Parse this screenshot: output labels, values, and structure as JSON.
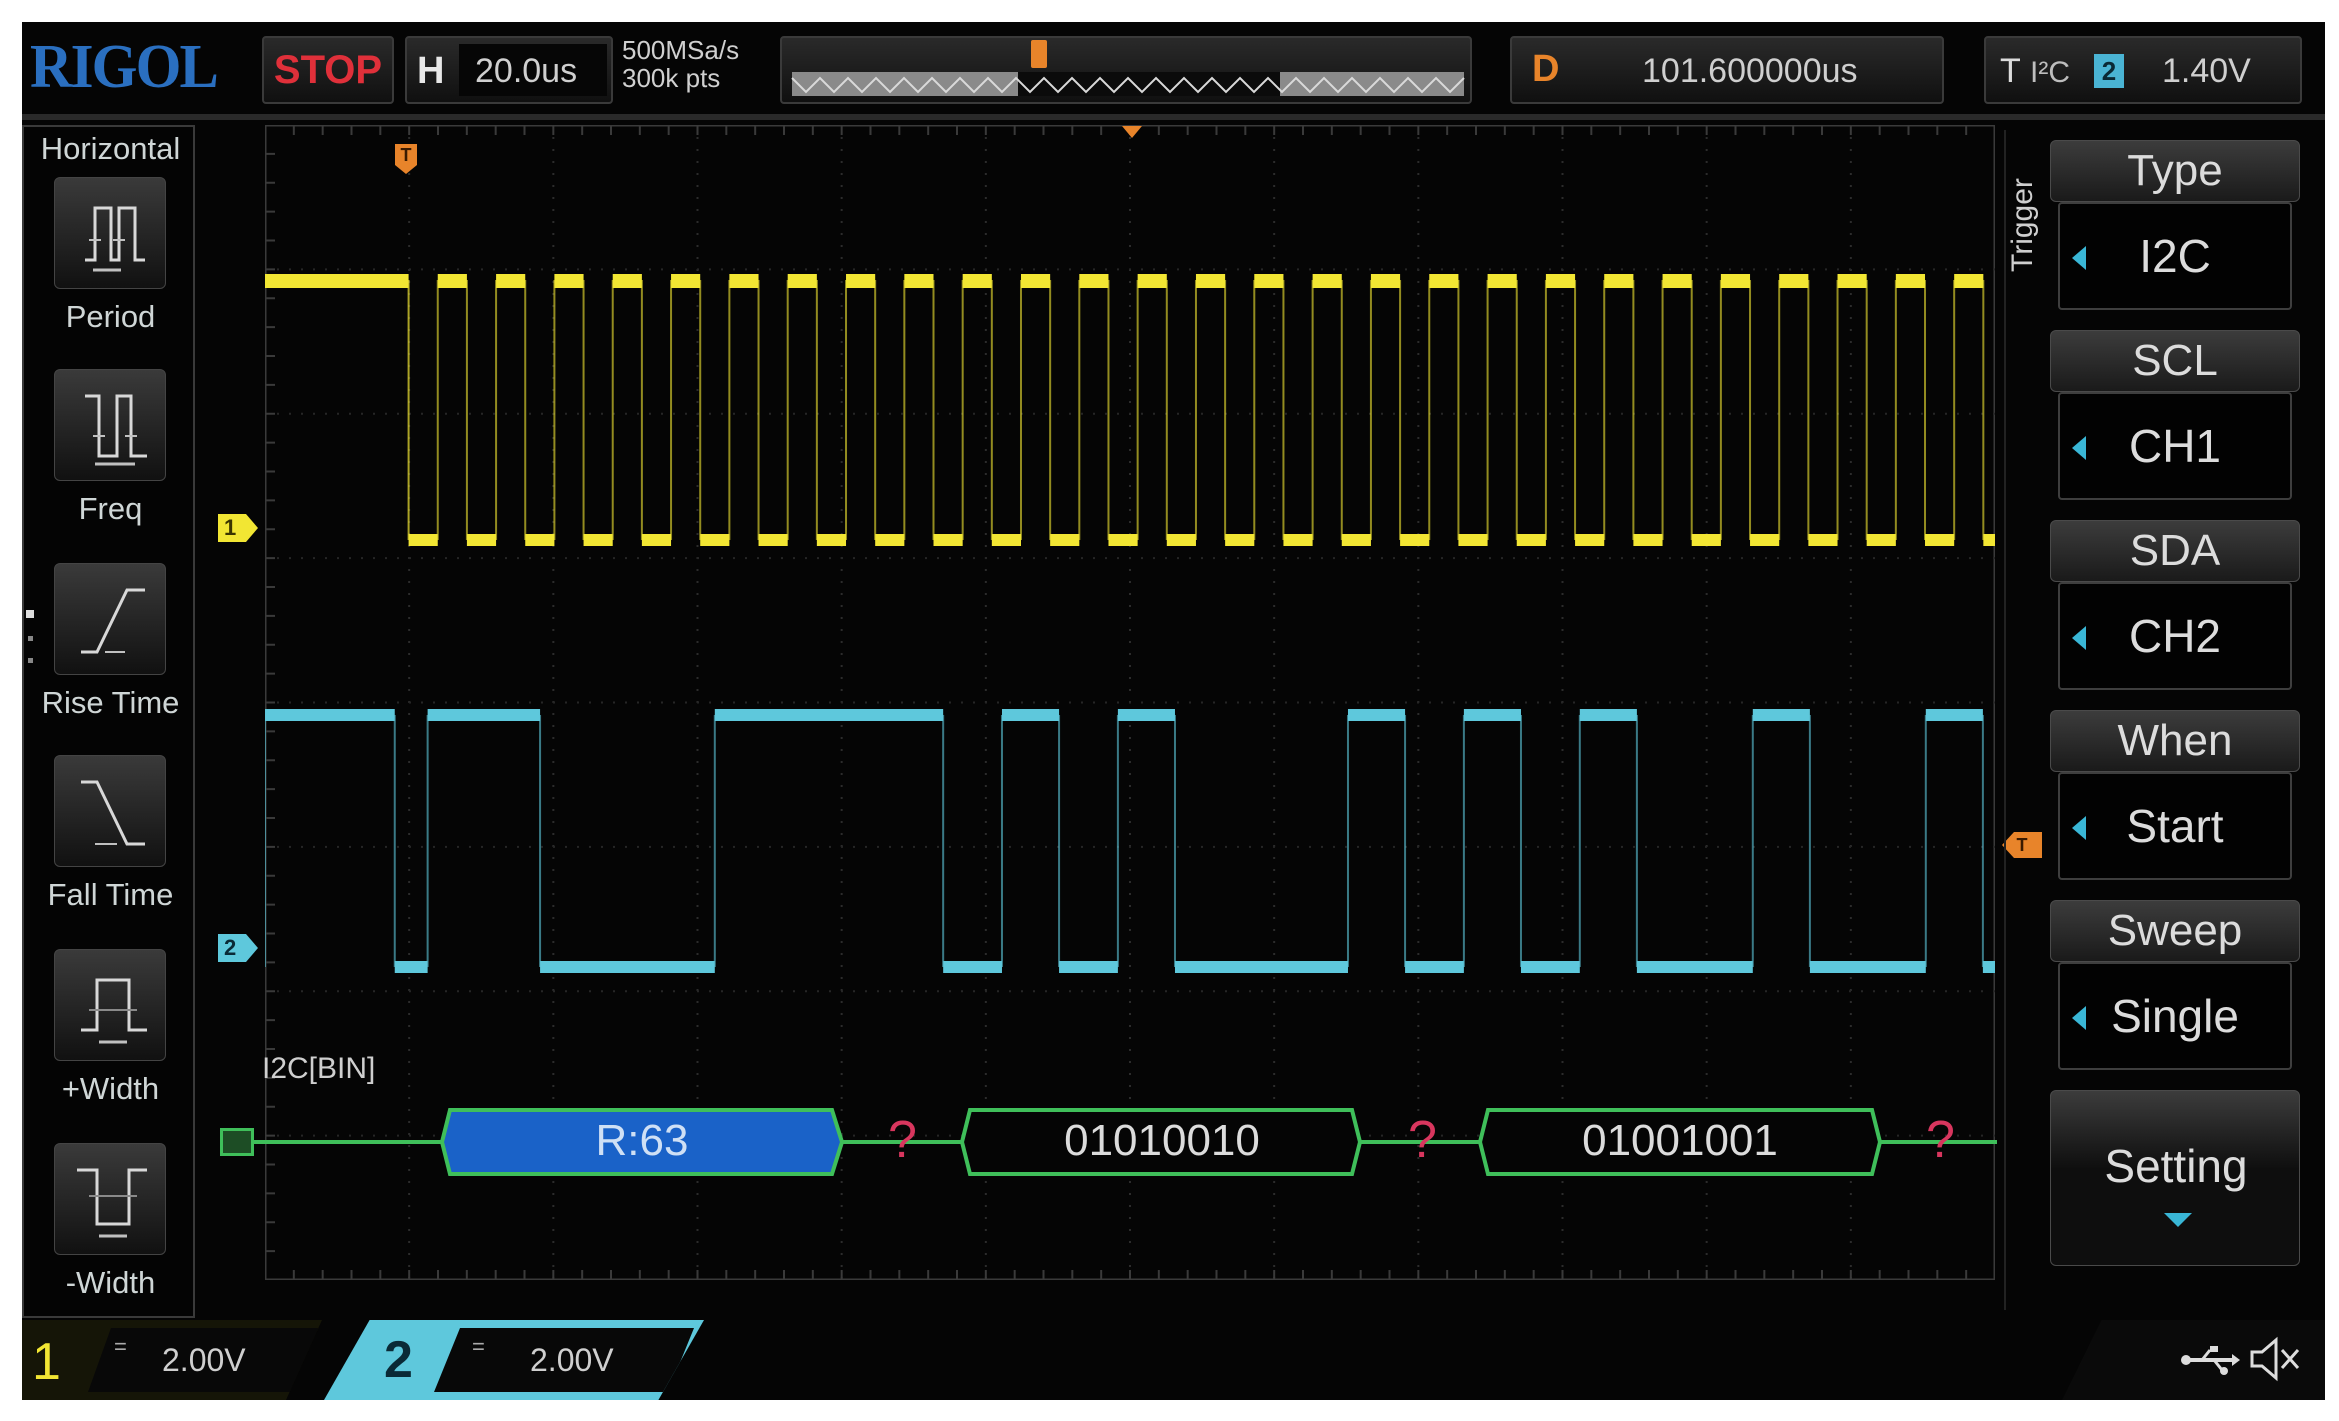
{
  "header": {
    "brand": "RIGOL",
    "run_state": "STOP",
    "horizontal_label": "H",
    "timebase": "20.0us",
    "sample_rate": "500MSa/s",
    "memory_depth": "300k pts",
    "delay_label": "D",
    "delay_value": "101.600000us",
    "trigger_label": "T",
    "trigger_type": "I²C",
    "trigger_source_channel": "2",
    "trigger_level": "1.40V"
  },
  "left_menu": {
    "title": "Horizontal",
    "items": [
      {
        "label": "Period",
        "icon": "period-icon"
      },
      {
        "label": "Freq",
        "icon": "frequency-icon"
      },
      {
        "label": "Rise Time",
        "icon": "rise-time-icon"
      },
      {
        "label": "Fall Time",
        "icon": "fall-time-icon"
      },
      {
        "label": "+Width",
        "icon": "positive-width-icon"
      },
      {
        "label": "-Width",
        "icon": "negative-width-icon"
      }
    ]
  },
  "right_menu": {
    "section_label": "Trigger",
    "items": [
      {
        "title": "Type",
        "value": "I2C"
      },
      {
        "title": "SCL",
        "value": "CH1"
      },
      {
        "title": "SDA",
        "value": "CH2"
      },
      {
        "title": "When",
        "value": "Start"
      },
      {
        "title": "Sweep",
        "value": "Single"
      }
    ],
    "setting_label": "Setting"
  },
  "channels": {
    "ch1": {
      "number": "1",
      "coupling_symbol": "=",
      "scale": "2.00V",
      "color": "#f2e633",
      "marker": "1"
    },
    "ch2": {
      "number": "2",
      "coupling_symbol": "=",
      "scale": "2.00V",
      "color": "#5ec8dc",
      "marker": "2"
    }
  },
  "decode": {
    "label": "I2C[BIN]",
    "bus_marker": "B1",
    "packets": [
      {
        "text": "R:63",
        "kind": "address"
      },
      {
        "text": "?",
        "kind": "ack-unknown"
      },
      {
        "text": "01010010",
        "kind": "data"
      },
      {
        "text": "?",
        "kind": "ack-unknown"
      },
      {
        "text": "01001001",
        "kind": "data"
      },
      {
        "text": "?",
        "kind": "ack-unknown"
      }
    ]
  },
  "markers": {
    "trigger_position": "T",
    "trigger_level": "T"
  },
  "colors": {
    "ch1": "#f2e633",
    "ch2": "#5ec8dc",
    "decode_bus": "#3fbf5a",
    "address_fill": "#1a62c8",
    "ack_unknown": "#d8365e",
    "trigger_marker": "#e8842a",
    "stop": "#e0303a",
    "brand": "#2a6fc0"
  },
  "waveforms": {
    "ch1_scl": {
      "idle_high_until_fraction": 0.083,
      "clock_pulse_count": 27,
      "note": "SCL clock after start condition"
    },
    "ch2_sda": {
      "high_segments_fraction": [
        [
          0.0,
          0.075
        ],
        [
          0.094,
          0.159
        ],
        [
          0.26,
          0.392
        ],
        [
          0.426,
          0.459
        ],
        [
          0.493,
          0.526
        ],
        [
          0.626,
          0.659
        ],
        [
          0.693,
          0.726
        ],
        [
          0.76,
          0.793
        ],
        [
          0.86,
          0.893
        ],
        [
          0.96,
          0.993
        ]
      ]
    }
  },
  "status_icons": [
    "usb-icon",
    "speaker-muted-icon"
  ]
}
